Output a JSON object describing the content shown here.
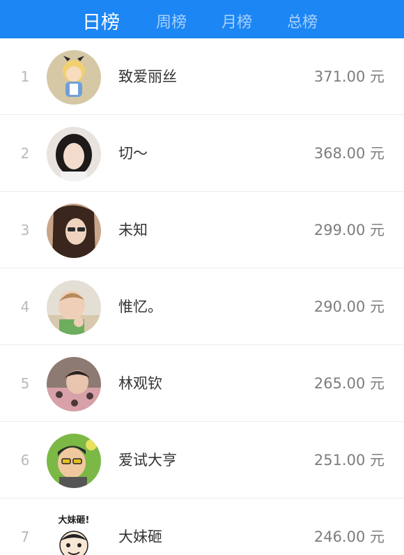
{
  "tabs": [
    {
      "label": "日榜",
      "active": true
    },
    {
      "label": "周榜",
      "active": false
    },
    {
      "label": "月榜",
      "active": false
    },
    {
      "label": "总榜",
      "active": false
    }
  ],
  "colors": {
    "header": "#1c86f5",
    "rank": "#b9b9b9",
    "name": "#333333",
    "amount": "#7d7d7d"
  },
  "ranking": [
    {
      "rank": "1",
      "name": "致爱丽丝",
      "amount": "371.00 元"
    },
    {
      "rank": "2",
      "name": "切～",
      "amount": "368.00 元"
    },
    {
      "rank": "3",
      "name": "未知",
      "amount": "299.00 元"
    },
    {
      "rank": "4",
      "name": "惟忆。",
      "amount": "290.00 元"
    },
    {
      "rank": "5",
      "name": "林观钦",
      "amount": "265.00 元"
    },
    {
      "rank": "6",
      "name": "爱试大亨",
      "amount": "251.00 元"
    },
    {
      "rank": "7",
      "name": "大妹砸",
      "amount": "246.00 元"
    }
  ],
  "avatar_badge_text": "大妹砸!"
}
